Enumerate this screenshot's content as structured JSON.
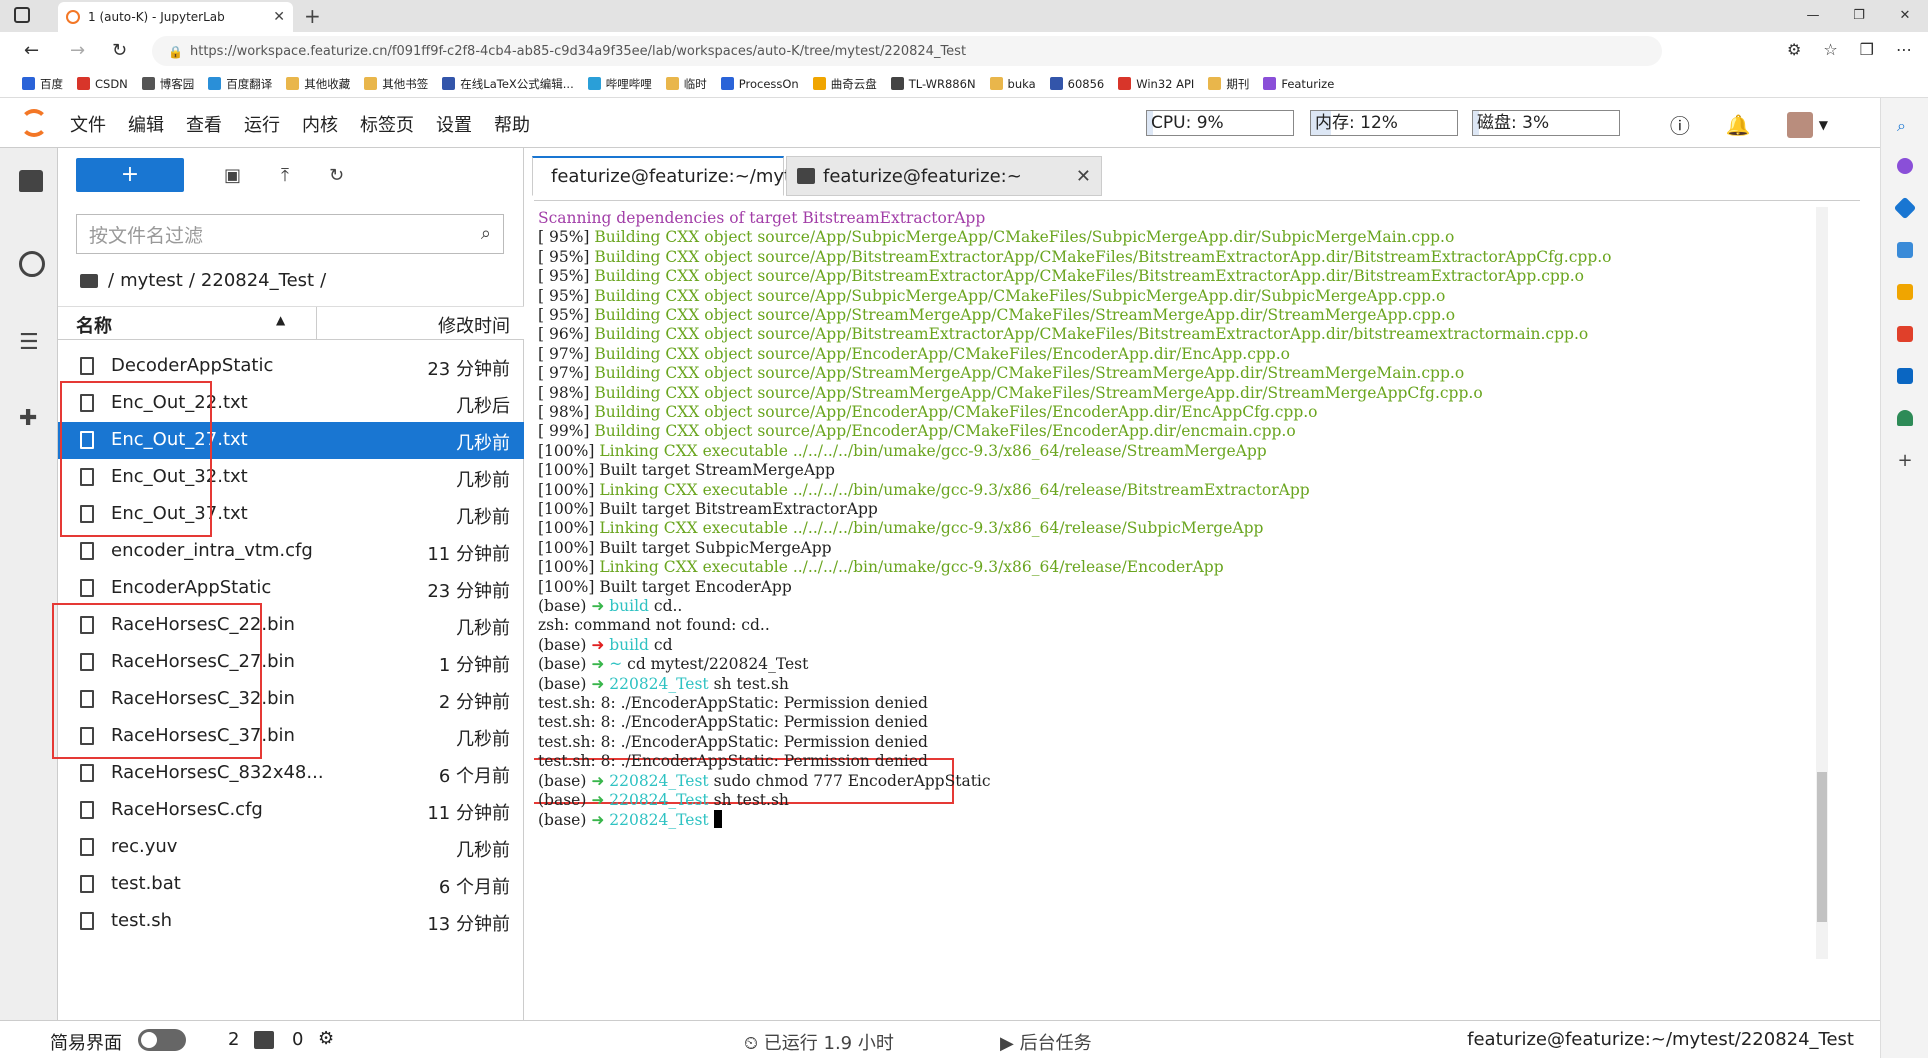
{
  "browser": {
    "tab_title": "1 (auto-K) - JupyterLab",
    "url": "https://workspace.featurize.cn/f091ff9f-c2f8-4cb4-ab85-c9d34a9f35ee/lab/workspaces/auto-K/tree/mytest/220824_Test",
    "bookmarks": [
      "百度",
      "CSDN",
      "博客园",
      "百度翻译",
      "其他收藏",
      "其他书签",
      "在线LaTeX公式编辑...",
      "哔哩哔哩",
      "临时",
      "ProcessOn",
      "曲奇云盘",
      "TL-WR886N",
      "buka",
      "60856",
      "Win32 API",
      "期刊",
      "Featurize"
    ]
  },
  "menu": {
    "items": [
      "文件",
      "编辑",
      "查看",
      "运行",
      "内核",
      "标签页",
      "设置",
      "帮助"
    ],
    "cpu": "CPU:  9%",
    "mem": "内存:  12%",
    "disk": "磁盘:  3%"
  },
  "filebrowser": {
    "filter_placeholder": "按文件名过滤",
    "crumbs": [
      "/",
      "mytest",
      "/",
      "220824_Test",
      "/"
    ],
    "col_name": "名称",
    "col_time": "修改时间",
    "files": [
      {
        "name": "DecoderAppStatic",
        "time": "23 分钟前"
      },
      {
        "name": "Enc_Out_22.txt",
        "time": "几秒后"
      },
      {
        "name": "Enc_Out_27.txt",
        "time": "几秒前"
      },
      {
        "name": "Enc_Out_32.txt",
        "time": "几秒前"
      },
      {
        "name": "Enc_Out_37.txt",
        "time": "几秒前"
      },
      {
        "name": "encoder_intra_vtm.cfg",
        "time": "11 分钟前"
      },
      {
        "name": "EncoderAppStatic",
        "time": "23 分钟前"
      },
      {
        "name": "RaceHorsesC_22.bin",
        "time": "几秒前"
      },
      {
        "name": "RaceHorsesC_27.bin",
        "time": "1 分钟前"
      },
      {
        "name": "RaceHorsesC_32.bin",
        "time": "2 分钟前"
      },
      {
        "name": "RaceHorsesC_37.bin",
        "time": "几秒前"
      },
      {
        "name": "RaceHorsesC_832x48...",
        "time": "6 个月前"
      },
      {
        "name": "RaceHorsesC.cfg",
        "time": "11 分钟前"
      },
      {
        "name": "rec.yuv",
        "time": "几秒前"
      },
      {
        "name": "test.bat",
        "time": "6 个月前"
      },
      {
        "name": "test.sh",
        "time": "13 分钟前"
      }
    ]
  },
  "terminal": {
    "tabs": [
      "featurize@featurize:~/mytes",
      "featurize@featurize:~"
    ],
    "lines": [
      [
        [
          "p",
          "Scanning dependencies of target BitstreamExtractorApp"
        ]
      ],
      [
        [
          "w",
          "[ 95%] "
        ],
        [
          "g",
          "Building CXX object source/App/SubpicMergeApp/CMakeFiles/SubpicMergeApp.dir/SubpicMergeMain.cpp.o"
        ]
      ],
      [
        [
          "w",
          "[ 95%] "
        ],
        [
          "g",
          "Building CXX object source/App/BitstreamExtractorApp/CMakeFiles/BitstreamExtractorApp.dir/BitstreamExtractorAppCfg.cpp.o"
        ]
      ],
      [
        [
          "w",
          "[ 95%] "
        ],
        [
          "g",
          "Building CXX object source/App/BitstreamExtractorApp/CMakeFiles/BitstreamExtractorApp.dir/BitstreamExtractorApp.cpp.o"
        ]
      ],
      [
        [
          "w",
          "[ 95%] "
        ],
        [
          "g",
          "Building CXX object source/App/SubpicMergeApp/CMakeFiles/SubpicMergeApp.dir/SubpicMergeApp.cpp.o"
        ]
      ],
      [
        [
          "w",
          "[ 95%] "
        ],
        [
          "g",
          "Building CXX object source/App/StreamMergeApp/CMakeFiles/StreamMergeApp.dir/StreamMergeApp.cpp.o"
        ]
      ],
      [
        [
          "w",
          "[ 96%] "
        ],
        [
          "g",
          "Building CXX object source/App/BitstreamExtractorApp/CMakeFiles/BitstreamExtractorApp.dir/bitstreamextractormain.cpp.o"
        ]
      ],
      [
        [
          "w",
          "[ 97%] "
        ],
        [
          "g",
          "Building CXX object source/App/EncoderApp/CMakeFiles/EncoderApp.dir/EncApp.cpp.o"
        ]
      ],
      [
        [
          "w",
          "[ 97%] "
        ],
        [
          "g",
          "Building CXX object source/App/StreamMergeApp/CMakeFiles/StreamMergeApp.dir/StreamMergeMain.cpp.o"
        ]
      ],
      [
        [
          "w",
          "[ 98%] "
        ],
        [
          "g",
          "Building CXX object source/App/StreamMergeApp/CMakeFiles/StreamMergeApp.dir/StreamMergeAppCfg.cpp.o"
        ]
      ],
      [
        [
          "w",
          "[ 98%] "
        ],
        [
          "g",
          "Building CXX object source/App/EncoderApp/CMakeFiles/EncoderApp.dir/EncAppCfg.cpp.o"
        ]
      ],
      [
        [
          "w",
          "[ 99%] "
        ],
        [
          "g",
          "Building CXX object source/App/EncoderApp/CMakeFiles/EncoderApp.dir/encmain.cpp.o"
        ]
      ],
      [
        [
          "w",
          "[100%] "
        ],
        [
          "g",
          "Linking CXX executable ../../../../bin/umake/gcc-9.3/x86_64/release/StreamMergeApp"
        ]
      ],
      [
        [
          "w",
          "[100%] Built target StreamMergeApp"
        ]
      ],
      [
        [
          "w",
          "[100%] "
        ],
        [
          "g",
          "Linking CXX executable ../../../../bin/umake/gcc-9.3/x86_64/release/BitstreamExtractorApp"
        ]
      ],
      [
        [
          "w",
          "[100%] Built target BitstreamExtractorApp"
        ]
      ],
      [
        [
          "w",
          "[100%] "
        ],
        [
          "g",
          "Linking CXX executable ../../../../bin/umake/gcc-9.3/x86_64/release/SubpicMergeApp"
        ]
      ],
      [
        [
          "w",
          "[100%] Built target SubpicMergeApp"
        ]
      ],
      [
        [
          "w",
          "[100%] "
        ],
        [
          "g",
          "Linking CXX executable ../../../../bin/umake/gcc-9.3/x86_64/release/EncoderApp"
        ]
      ],
      [
        [
          "w",
          "[100%] Built target EncoderApp"
        ]
      ],
      [
        [
          "w",
          "(base) "
        ],
        [
          "gr",
          "➜ "
        ],
        [
          "c",
          "build "
        ],
        [
          "w",
          "cd.."
        ]
      ],
      [
        [
          "w",
          "zsh: command not found: cd.."
        ]
      ],
      [
        [
          "w",
          "(base) "
        ],
        [
          "rd",
          "➜ "
        ],
        [
          "c",
          "build "
        ],
        [
          "w",
          "cd"
        ]
      ],
      [
        [
          "w",
          "(base) "
        ],
        [
          "gr",
          "➜ "
        ],
        [
          "c",
          "~ "
        ],
        [
          "w",
          "cd mytest/220824_Test"
        ]
      ],
      [
        [
          "w",
          "(base) "
        ],
        [
          "gr",
          "➜ "
        ],
        [
          "c",
          "220824_Test "
        ],
        [
          "w",
          "sh test.sh"
        ]
      ],
      [
        [
          "w",
          "test.sh: 8: ./EncoderAppStatic: Permission denied"
        ]
      ],
      [
        [
          "w",
          "test.sh: 8: ./EncoderAppStatic: Permission denied"
        ]
      ],
      [
        [
          "w",
          "test.sh: 8: ./EncoderAppStatic: Permission denied"
        ]
      ],
      [
        [
          "w",
          "test.sh: 8: ./EncoderAppStatic: Permission denied"
        ]
      ],
      [
        [
          "w",
          "(base) "
        ],
        [
          "gr",
          "➜ "
        ],
        [
          "c",
          "220824_Test "
        ],
        [
          "w",
          "sudo chmod 777 EncoderAppStatic"
        ]
      ],
      [
        [
          "w",
          "(base) "
        ],
        [
          "gr",
          "➜ "
        ],
        [
          "c",
          "220824_Test "
        ],
        [
          "w",
          "sh test.sh"
        ]
      ],
      [
        [
          "w",
          "(base) "
        ],
        [
          "gr",
          "➜ "
        ],
        [
          "c",
          "220824_Test "
        ]
      ]
    ]
  },
  "status": {
    "simple": "简易界面",
    "terminals_count": "2",
    "kernels_count": "0",
    "running": "已运行 1.9 小时",
    "background": "后台任务",
    "path": "featurize@featurize:~/mytest/220824_Test"
  },
  "colors": {
    "accent": "#1976d2",
    "highlight": "#e53935",
    "jupyter_orange": "#f37726"
  }
}
